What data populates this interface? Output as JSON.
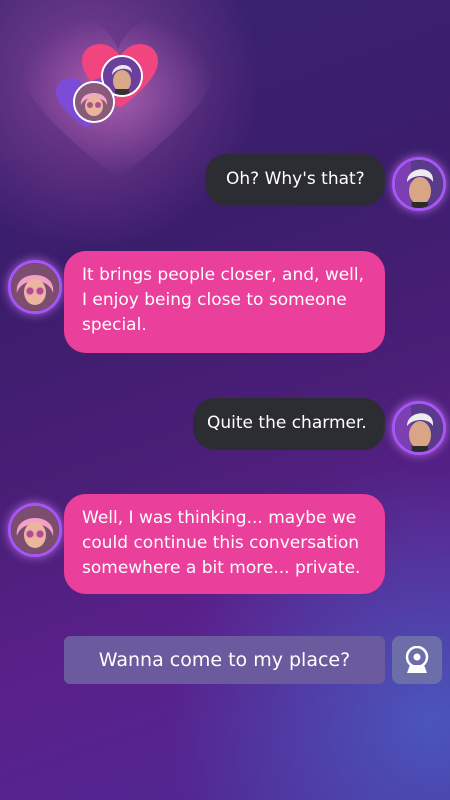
{
  "header": {
    "logo_icon": "hearts-couple-logo-icon"
  },
  "messages": [
    {
      "sender": "player",
      "text": "Oh? Why's that?"
    },
    {
      "sender": "partner",
      "text": "It brings people closer, and, well, I enjoy being close to someone special."
    },
    {
      "sender": "player",
      "text": "Quite the charmer."
    },
    {
      "sender": "partner",
      "text": "Well, I was thinking... maybe we could continue this conversation somewhere a bit more... private."
    }
  ],
  "reply_option": {
    "text": "Wanna come to my place?"
  },
  "mic_button": {
    "icon": "voice-record-icon"
  },
  "colors": {
    "player_bubble": "#2c2c33",
    "partner_bubble": "#ea3f9a",
    "avatar_ring": "#a855f7",
    "reply_bar": "#6b5a9e"
  }
}
